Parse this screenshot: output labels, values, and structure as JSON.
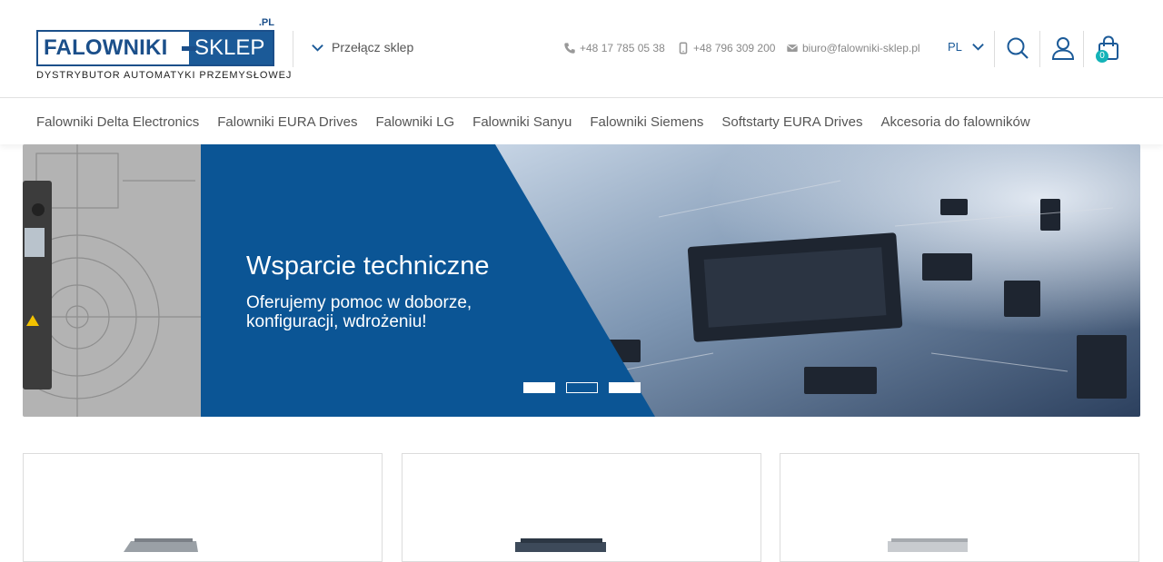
{
  "brand": {
    "domain_suffix": ".PL",
    "name_left": "FALOWNIKI",
    "name_right": "SKLEP",
    "tagline": "DYSTRYBUTOR AUTOMATYKI PRZEMYSŁOWEJ",
    "color_primary": "#1b5a98"
  },
  "header": {
    "switch_shop_label": "Przełącz sklep",
    "phone": "+48 17 785 05 38",
    "mobile": "+48 796 309 200",
    "email": "biuro@falowniki-sklep.pl",
    "language": "PL",
    "cart_count": "0",
    "accent_color": "#14b3b8"
  },
  "nav": {
    "items": [
      {
        "label": "Falowniki Delta Electronics"
      },
      {
        "label": "Falowniki EURA Drives"
      },
      {
        "label": "Falowniki LG"
      },
      {
        "label": "Falowniki Sanyu"
      },
      {
        "label": "Falowniki Siemens"
      },
      {
        "label": "Softstarty EURA Drives"
      },
      {
        "label": "Akcesoria do falowników"
      }
    ]
  },
  "banner": {
    "title": "Wsparcie techniczne",
    "text": "Oferujemy pomoc w doborze, konfiguracji, wdrożeniu!",
    "slides_count": 3,
    "active_slide": 2,
    "panel_color": "#0b5595"
  },
  "products": {
    "cards_visible": 3
  }
}
